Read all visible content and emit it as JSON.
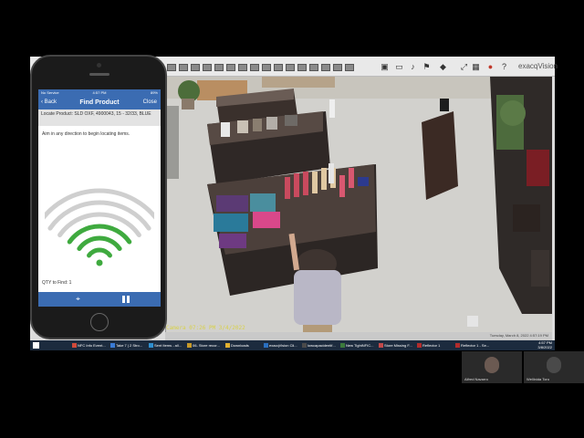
{
  "toolbar": {
    "brand": "exacqVision",
    "layout_buttons": 16
  },
  "phone": {
    "status": {
      "carrier": "No Service",
      "time": "4:57 PM",
      "battery": "89%"
    },
    "nav": {
      "back": "Back",
      "title": "Find Product",
      "close": "Close"
    },
    "locate_text": "Locate Product: SLD OXF, 4900043, 15 - 32/33, BLUE",
    "aim_text": "Aim in any direction to begin locating items.",
    "qty_text": "QTY to Find: 1",
    "signal_bars_active": 3,
    "signal_bars_total": 6,
    "colors": {
      "header": "#3b6cb2",
      "active": "#3faa3f",
      "inactive": "#cfcfcf"
    }
  },
  "camera": {
    "timestamp": "Camera 07:26 PM 3/4/2022",
    "bottom_text": "Tuesday, March 8, 2022    4:57:19 PM"
  },
  "taskbar": {
    "tasks": [
      "NFC Info Event...",
      "Take 7 | 2 Stro...",
      "Sent Items - all...",
      "06- Store recor...",
      "Downloads",
      "exacqVision Cli...",
      "lowcapacidentif...",
      "New TightNFIC...",
      "Store Missing F...",
      "Reflector 1",
      "Reflector 1 - Se..."
    ],
    "clock_time": "4:57 PM",
    "clock_date": "3/8/2022"
  },
  "participants": [
    {
      "name": "Alfred Navarro"
    },
    {
      "name": "Wellinida Toro"
    }
  ]
}
